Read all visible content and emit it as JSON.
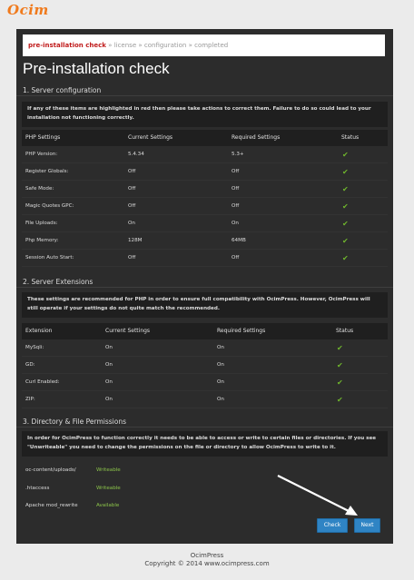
{
  "logo": "Ocim",
  "breadcrumb": {
    "active": "pre-installation check",
    "sep": "»",
    "steps": [
      "license",
      "configuration",
      "completed"
    ]
  },
  "page_title": "Pre-installation check",
  "server_config": {
    "title": "1. Server configuration",
    "info": "If any of these items are highlighted in red then please take actions to correct them. Failure to do so could lead to your installation not functioning correctly.",
    "headers": [
      "PHP Settings",
      "Current Settings",
      "Required Settings",
      "Status"
    ],
    "rows": [
      {
        "name": "PHP Version:",
        "current": "5.4.34",
        "required": "5.3+",
        "status": "✔"
      },
      {
        "name": "Register Globals:",
        "current": "Off",
        "required": "Off",
        "status": "✔"
      },
      {
        "name": "Safe Mode:",
        "current": "Off",
        "required": "Off",
        "status": "✔"
      },
      {
        "name": "Magic Quotes GPC:",
        "current": "Off",
        "required": "Off",
        "status": "✔"
      },
      {
        "name": "File Uploads:",
        "current": "On",
        "required": "On",
        "status": "✔"
      },
      {
        "name": "Php Memory:",
        "current": "128M",
        "required": "64MB",
        "status": "✔"
      },
      {
        "name": "Session Auto Start:",
        "current": "Off",
        "required": "Off",
        "status": "✔"
      }
    ]
  },
  "server_ext": {
    "title": "2. Server Extensions",
    "info": "These settings are recommended for PHP in order to ensure full compatibility with OcimPress. However, OcimPress will still operate if your settings do not quite match the recommended.",
    "headers": [
      "Extension",
      "Current Settings",
      "Required Settings",
      "Status"
    ],
    "rows": [
      {
        "name": "MySqli:",
        "current": "On",
        "required": "On",
        "status": "✔"
      },
      {
        "name": "GD:",
        "current": "On",
        "required": "On",
        "status": "✔"
      },
      {
        "name": "Curl Enabled:",
        "current": "On",
        "required": "On",
        "status": "✔"
      },
      {
        "name": "ZIP:",
        "current": "On",
        "required": "On",
        "status": "✔"
      }
    ]
  },
  "permissions": {
    "title": "3. Directory & File Permissions",
    "info": "In order for OcimPress to function correctly it needs to be able to access or write to certain files or directories. If you see \"Unwriteable\" you need to change the permissions on the file or directory to allow OcimPress to write to it.",
    "rows": [
      {
        "name": "oc-content/uploads/",
        "status": "Writeable"
      },
      {
        "name": ".htaccess",
        "status": "Writeable"
      },
      {
        "name": "Apache mod_rewrite",
        "status": "Available"
      }
    ]
  },
  "buttons": {
    "check": "Check",
    "next": "Next"
  },
  "footer": {
    "line1": "OcimPress",
    "line2": "Copyright © 2014 www.ocimpress.com"
  },
  "colors": {
    "accent": "#2f84c4",
    "ok": "#6fb52c",
    "crumb_active": "#c01b1b",
    "logo": "#f07a1c"
  }
}
